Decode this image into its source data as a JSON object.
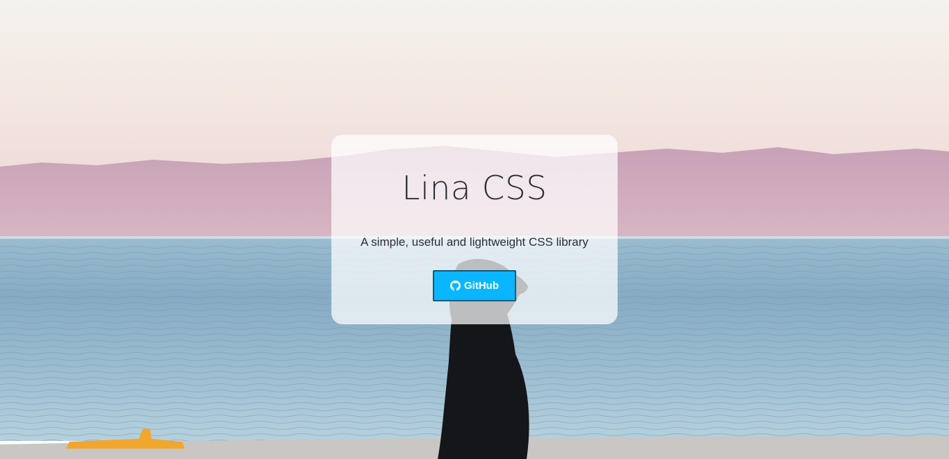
{
  "hero": {
    "title": "Lina CSS",
    "subtitle": "A simple, useful and lightweight CSS library",
    "button": {
      "label": "GitHub",
      "icon": "github-icon"
    }
  },
  "colors": {
    "button_bg": "#0ab6ff",
    "button_border": "#0c5a78",
    "text": "#2b2f38",
    "card_bg": "rgba(255,255,255,0.72)"
  }
}
